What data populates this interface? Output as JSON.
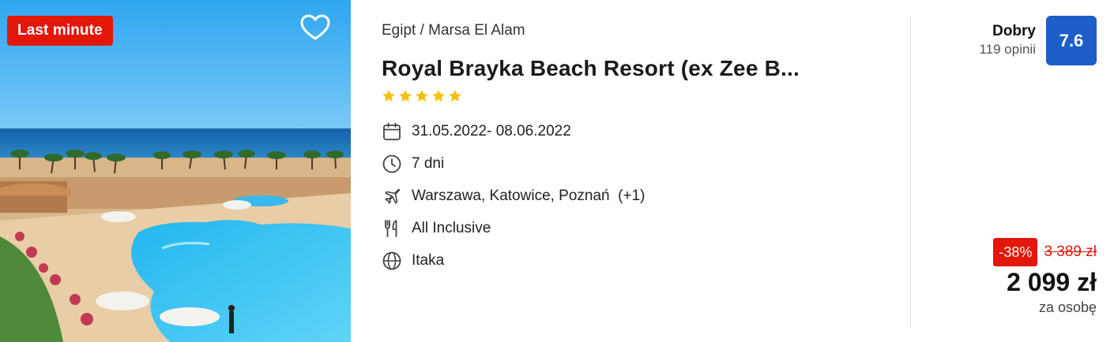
{
  "offer": {
    "badge": "Last minute",
    "location": "Egipt / Marsa El Alam",
    "title": "Royal Brayka Beach Resort (ex Zee B...",
    "stars": 5,
    "dates": "31.05.2022- 08.06.2022",
    "duration": "7 dni",
    "departures": "Warszawa, Katowice, Poznań  (+1)",
    "board": "All Inclusive",
    "operator": "Itaka"
  },
  "rating": {
    "label": "Dobry",
    "count": "119 opinii",
    "score": "7.6"
  },
  "price": {
    "discount": "-38%",
    "old": "3 389 zł",
    "current": "2 099 zł",
    "per": "za osobę"
  },
  "colors": {
    "accent_red": "#e3170a",
    "rating_blue": "#1c5dc8",
    "star_yellow": "#f5c200"
  },
  "icons": [
    "heart-icon",
    "calendar-icon",
    "clock-icon",
    "plane-icon",
    "cutlery-icon",
    "globe-icon",
    "star-icon"
  ]
}
